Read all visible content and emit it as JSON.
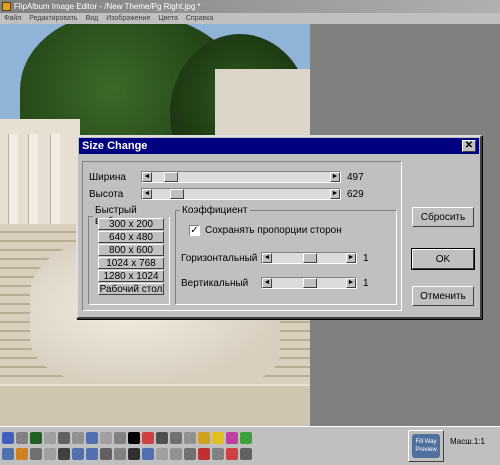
{
  "app": {
    "title": "FlipAlbum Image Editor - /New Theme/Pg Right.jpg *",
    "menu": [
      "Файл",
      "Редактировать",
      "Вид",
      "Изображение",
      "Цвета",
      "Справка"
    ]
  },
  "dialog": {
    "title": "Size Change",
    "close_label": "✕",
    "width_label": "Ширина",
    "width_value": "497",
    "height_label": "Высота",
    "height_value": "629",
    "quick": {
      "legend": "Быстрый выбор",
      "presets": [
        "300 x 200",
        "640 x 480",
        "800 x 600",
        "1024 x 768",
        "1280 x 1024",
        "Рабочий стол"
      ]
    },
    "coef": {
      "legend": "Коэффициент",
      "keep_ratio_label": "Сохранять пропорции сторон",
      "keep_ratio_checked": true,
      "horizontal_label": "Горизонтальный",
      "horizontal_value": "1",
      "vertical_label": "Вертикальный",
      "vertical_value": "1"
    },
    "buttons": {
      "reset": "Сбросить",
      "ok": "OK",
      "cancel": "Отменить"
    }
  },
  "statusbar": {
    "zoom_label": "Масш.1:1",
    "fill_button": "Fill Way Preview"
  },
  "colors": {
    "dialog_title_bg": "#000080",
    "window_bg": "#c0c0c0"
  }
}
